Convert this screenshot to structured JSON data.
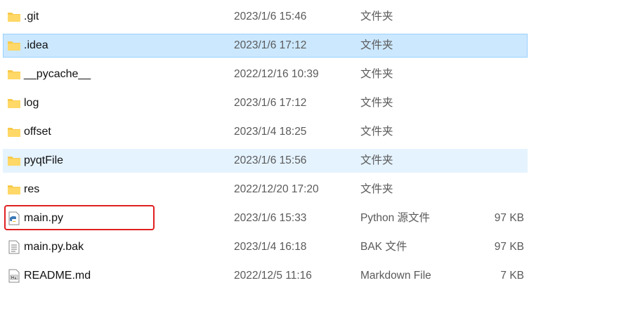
{
  "files": [
    {
      "name": ".git",
      "date": "2023/1/6 15:46",
      "type": "文件夹",
      "size": "",
      "icon": "folder-icon",
      "state": "normal"
    },
    {
      "name": ".idea",
      "date": "2023/1/6 17:12",
      "type": "文件夹",
      "size": "",
      "icon": "folder-icon",
      "state": "selected"
    },
    {
      "name": "__pycache__",
      "date": "2022/12/16 10:39",
      "type": "文件夹",
      "size": "",
      "icon": "folder-icon",
      "state": "normal"
    },
    {
      "name": "log",
      "date": "2023/1/6 17:12",
      "type": "文件夹",
      "size": "",
      "icon": "folder-icon",
      "state": "normal"
    },
    {
      "name": "offset",
      "date": "2023/1/4 18:25",
      "type": "文件夹",
      "size": "",
      "icon": "folder-icon",
      "state": "normal"
    },
    {
      "name": "pyqtFile",
      "date": "2023/1/6 15:56",
      "type": "文件夹",
      "size": "",
      "icon": "folder-icon",
      "state": "hovered"
    },
    {
      "name": "res",
      "date": "2022/12/20 17:20",
      "type": "文件夹",
      "size": "",
      "icon": "folder-icon",
      "state": "normal"
    },
    {
      "name": "main.py",
      "date": "2023/1/6 15:33",
      "type": "Python 源文件",
      "size": "97 KB",
      "icon": "python-file-icon",
      "state": "normal"
    },
    {
      "name": "main.py.bak",
      "date": "2023/1/4 16:18",
      "type": "BAK 文件",
      "size": "97 KB",
      "icon": "text-file-icon",
      "state": "normal"
    },
    {
      "name": "README.md",
      "date": "2022/12/5 11:16",
      "type": "Markdown File",
      "size": "7 KB",
      "icon": "markdown-file-icon",
      "state": "normal"
    }
  ],
  "colors": {
    "selected_bg": "#cce8ff",
    "hover_bg": "#e5f3ff",
    "highlight_border": "#e02020",
    "folder_yellow": "#f8c94a"
  }
}
